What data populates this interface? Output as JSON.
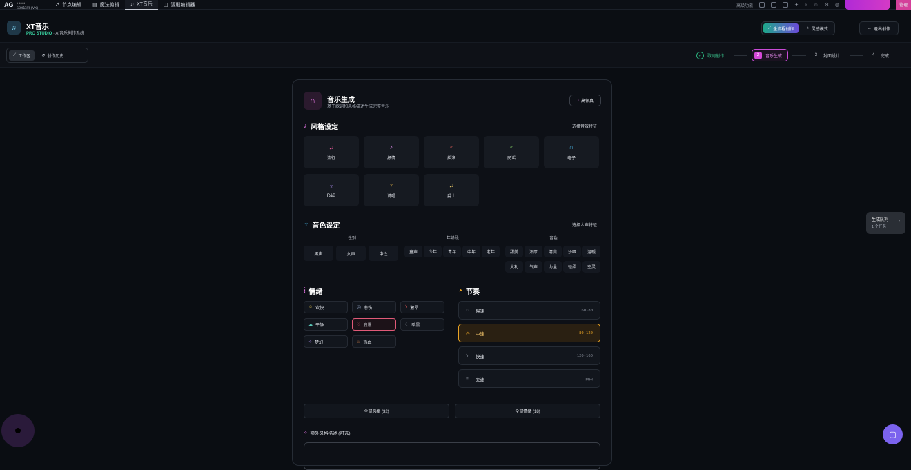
{
  "topbar": {
    "logo": "AG",
    "user_line1": "• ••••",
    "user_line2": "sextam (vx)",
    "tabs": [
      {
        "label": "节点编辑",
        "icon": "node-icon"
      },
      {
        "label": "魔法剪辑",
        "icon": "film-icon"
      },
      {
        "label": "XT音乐",
        "icon": "music-icon",
        "active": true
      },
      {
        "label": "源剧编辑器",
        "icon": "layout-icon"
      }
    ],
    "advanced": "高级功能",
    "admin": "管理"
  },
  "header": {
    "title": "XT音乐",
    "brand": "PRO STUDIO",
    "subtitle": "· AI音乐创作系统",
    "mode_full": "全流程创作",
    "mode_quick": "灵感模式",
    "exit": "退出创作"
  },
  "subbar": {
    "workspace": "工作区",
    "history": "创作历史",
    "steps": [
      {
        "num": "✓",
        "label": "歌词创作",
        "state": "done"
      },
      {
        "num": "2",
        "label": "音乐生成",
        "state": "current"
      },
      {
        "num": "3",
        "label": "封面设计",
        "state": "todo"
      },
      {
        "num": "4",
        "label": "完成",
        "state": "todo"
      }
    ]
  },
  "card": {
    "title": "音乐生成",
    "subtitle": "基于歌词和风格描述生成完整音乐",
    "hifi": "高保真",
    "style_section": "风格设定",
    "style_link": "选择音效特征",
    "styles": [
      {
        "label": "流行",
        "color": "#e85a9a"
      },
      {
        "label": "抒情",
        "color": "#d88ae8"
      },
      {
        "label": "摇滚",
        "color": "#e8605a"
      },
      {
        "label": "民谣",
        "color": "#8ad86a"
      },
      {
        "label": "电子",
        "color": "#4ab8e8"
      },
      {
        "label": "R&B",
        "color": "#a88ae8"
      },
      {
        "label": "说唱",
        "color": "#e8b84a"
      },
      {
        "label": "爵士",
        "color": "#e8c86a"
      }
    ],
    "voice_section": "音色设定",
    "voice_link": "选择人声特征",
    "gender_head": "性别",
    "genders": [
      "男声",
      "女声",
      "中性"
    ],
    "age_head": "年龄段",
    "ages": [
      "童声",
      "少年",
      "青年",
      "中年",
      "老年"
    ],
    "timbre_head": "音色",
    "timbres": [
      "甜美",
      "浑厚",
      "清亮",
      "沙哑",
      "温暖",
      "犬利",
      "气声",
      "力量",
      "轻柔",
      "空灵"
    ],
    "mood_section": "情绪",
    "moods": [
      {
        "label": "欢快",
        "icon": "smile-icon",
        "color": "#e8c84a"
      },
      {
        "label": "悲伤",
        "icon": "sad-icon",
        "color": "#8a9ab8"
      },
      {
        "label": "激昂",
        "icon": "bolt-icon",
        "color": "#e85a5a"
      },
      {
        "label": "平静",
        "icon": "cloud-icon",
        "color": "#5ac8b8"
      },
      {
        "label": "浪漫",
        "icon": "heart-icon",
        "color": "#e85a78",
        "selected": true
      },
      {
        "label": "暗黑",
        "icon": "moon-icon",
        "color": "#9aa0ab"
      },
      {
        "label": "梦幻",
        "icon": "sparkle-icon",
        "color": "#a88ae8"
      },
      {
        "label": "热血",
        "icon": "flame-icon",
        "color": "#e8884a"
      }
    ],
    "tempo_section": "节奏",
    "tempos": [
      {
        "label": "慢速",
        "range": "60-80",
        "icon": "snail-icon"
      },
      {
        "label": "中速",
        "range": "80-120",
        "icon": "clock-icon",
        "selected": true
      },
      {
        "label": "快速",
        "range": "120-160",
        "icon": "lightning-icon"
      },
      {
        "label": "变速",
        "range": "自由",
        "icon": "lines-icon"
      }
    ],
    "all_styles": "全部风格 (32)",
    "all_moods": "全部情绪 (18)",
    "extra_label": "额外风格描述 (可选)"
  },
  "queue": {
    "title": "生成队列",
    "count": "1 个任务"
  }
}
